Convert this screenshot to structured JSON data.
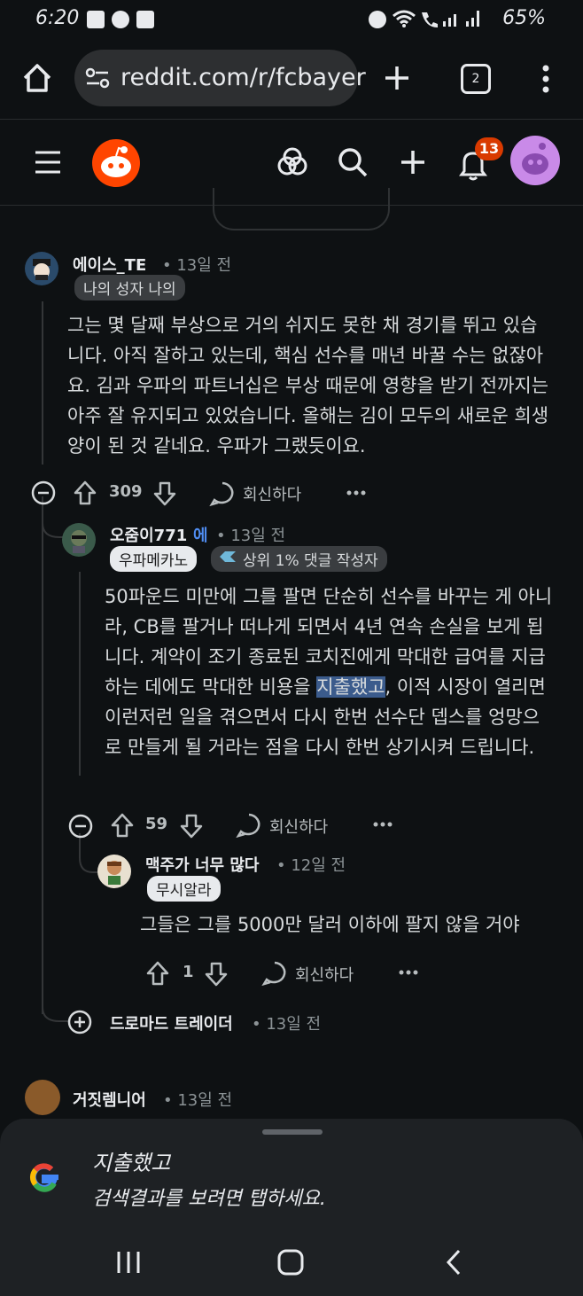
{
  "status": {
    "time": "6:20",
    "battery": "65%"
  },
  "browser": {
    "url": "reddit.com/r/fcbayer",
    "tab_count": "2"
  },
  "header": {
    "notification_count": "13"
  },
  "comments": [
    {
      "username": "에이스_TE",
      "time": "• 13일 전",
      "flair": "나의 성자 나의",
      "body": "그는 몇 달째 부상으로 거의 쉬지도 못한 채 경기를 뛰고 있습니다. 아직 잘하고 있는데, 핵심 선수를 매년 바꿀 수는 없잖아요. 김과 우파의 파트너십은 부상 때문에 영향을 받기 전까지는 아주 잘 유지되고 있었습니다. 올해는 김이 모두의 새로운 희생양이 된 것 같네요. 우파가 그랬듯이요.",
      "votes": "309",
      "reply_label": "회신하다"
    },
    {
      "username": "오줌이771",
      "op_tag": "에",
      "time": "• 13일 전",
      "flair": "우파메카노",
      "flair2": "상위 1% 댓글 작성자",
      "body_before": "50파운드 미만에 그를 팔면 단순히 선수를 바꾸는 게 아니라, CB를 팔거나 떠나게 되면서 4년 연속 손실을 보게 됩니다. 계약이 조기 종료된 코치진에게 막대한 급여를 지급하는 데에도 막대한 비용을 ",
      "body_highlight": "지출했고",
      "body_after": ", 이적 시장이 열리면 이런저런 일을 겪으면서 다시 한번 선수단 뎁스를 엉망으로 만들게 될 거라는 점을 다시 한번 상기시켜 드립니다.",
      "votes": "59",
      "reply_label": "회신하다"
    },
    {
      "username": "맥주가 너무 많다",
      "time": "• 12일 전",
      "flair": "무시알라",
      "body": "그들은 그를 5000만 달러 이하에 팔지 않을 거야",
      "votes": "1",
      "reply_label": "회신하다"
    }
  ],
  "collapsed_reply": {
    "username": "드로마드 트레이더",
    "time": "• 13일 전"
  },
  "next_comment": {
    "username": "거짓렘니어",
    "time": "• 13일 전"
  },
  "google_sheet": {
    "term": "지출했고",
    "hint": "검색결과를 보려면 탭하세요."
  },
  "colors": {
    "reddit_orange": "#ff4500",
    "background": "#0e1113",
    "highlight": "#3b5b8c"
  }
}
